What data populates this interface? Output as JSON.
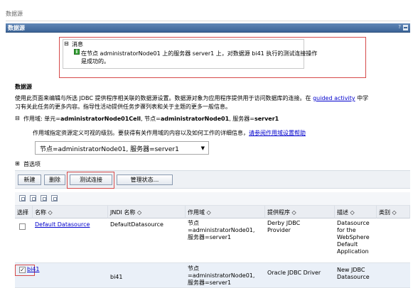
{
  "page_label": "数据源",
  "title_bar": {
    "title": "数据源",
    "help": "?"
  },
  "message": {
    "toggle": "⊟",
    "heading": "消息",
    "line1": "在节点 administratorNode01 上的服务器 server1 上，对数据源 bi41 执行的测试连接操作",
    "line2": "是成功的。"
  },
  "section": {
    "heading": "数据源",
    "desc1_pre": "使用此页面来编辑与所选 JDBC 提供程序相关联的数据源设置。数据源对象为应用程序提供用于访问数据库的连接。在 ",
    "desc1_link": "guided activity",
    "desc1_post": " 中学",
    "desc2": "习有关此任务的更多内容。指导性活动提供任务步骤列表和关于主题的更多一般信息。"
  },
  "scope": {
    "toggle": "⊟",
    "prefix": "作用域: 单元=",
    "cell": "administratorNode01Cell",
    "sep1": ", 节点=",
    "node": "administratorNode01",
    "sep2": ", 服务器=",
    "server": "server1",
    "help_text": "作用域指定资源定义可视的级别。要获得有关作用域的内容以及如何工作的详细信息，",
    "help_link": "请参阅作用域设置帮助",
    "select_value": "节点=administratorNode01, 服务器=server1",
    "select_arrow": "▼"
  },
  "preferences": {
    "toggle": "⊞",
    "label": "首选项"
  },
  "toolbar": {
    "new_label": "新建",
    "delete_label": "删除",
    "test_label": "测试连接",
    "status_label": "管理状态..."
  },
  "table": {
    "headers": [
      "选择",
      "名称 ◇",
      "JNDI 名称 ◇",
      "作用域 ◇",
      "提供程序 ◇",
      "描述 ◇",
      "类别 ◇"
    ],
    "rows": [
      {
        "checked": "",
        "name": "Default Datasource",
        "jndi": "DefaultDatasource",
        "scope_l1": "节点",
        "scope_l2": "=administratorNode01,",
        "scope_l3": "服务器=server1",
        "provider_l1": "Derby JDBC",
        "provider_l2": "Provider",
        "desc_l1": "Datasource",
        "desc_l2": "for the",
        "desc_l3": "WebSphere",
        "desc_l4": "Default",
        "desc_l5": "Application"
      },
      {
        "checked": "✓",
        "name": "bi41",
        "jndi": "bi41",
        "scope_l1": "节点",
        "scope_l2": "=administratorNode01,",
        "scope_l3": "服务器=server1",
        "provider_l1": "Oracle JDBC Driver",
        "desc_l1": "New JDBC",
        "desc_l2": "Datasource"
      }
    ]
  }
}
